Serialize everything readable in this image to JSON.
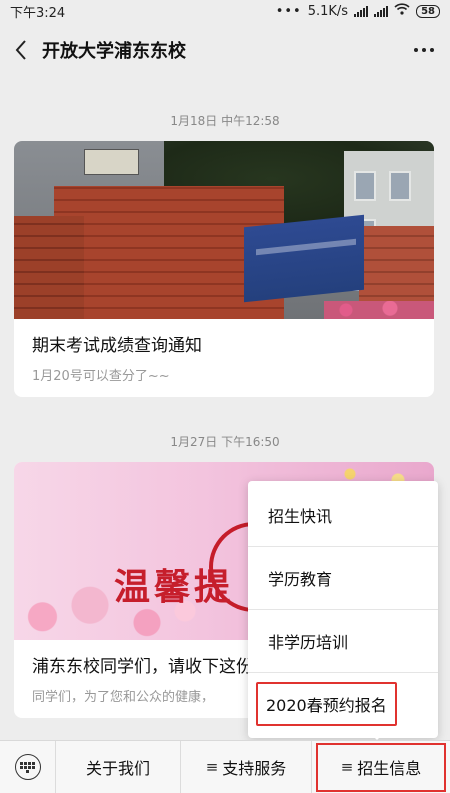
{
  "status_bar": {
    "time": "下午3:24",
    "network_speed": "5.1K/s",
    "battery": "58"
  },
  "header": {
    "title": "开放大学浦东东校"
  },
  "messages": [
    {
      "timestamp": "1月18日 中午12:58",
      "title": "期末考试成绩查询通知",
      "description": "1月20号可以查分了~~"
    },
    {
      "timestamp": "1月27日 下午16:50",
      "title": "浦东东校同学们，请收下这份",
      "description": "同学们，为了您和公众的健康，",
      "cover_text": "温馨提"
    }
  ],
  "popup_menu": {
    "items": [
      {
        "label": "招生快讯"
      },
      {
        "label": "学历教育"
      },
      {
        "label": "非学历培训"
      },
      {
        "label": "2020春预约报名"
      }
    ],
    "highlight_color": "#e0322f"
  },
  "bottom_menu": {
    "items": [
      {
        "label": "关于我们",
        "has_submenu": false
      },
      {
        "label": "支持服务",
        "has_submenu": true
      },
      {
        "label": "招生信息",
        "has_submenu": true
      }
    ],
    "submenu_glyph": "≡"
  }
}
